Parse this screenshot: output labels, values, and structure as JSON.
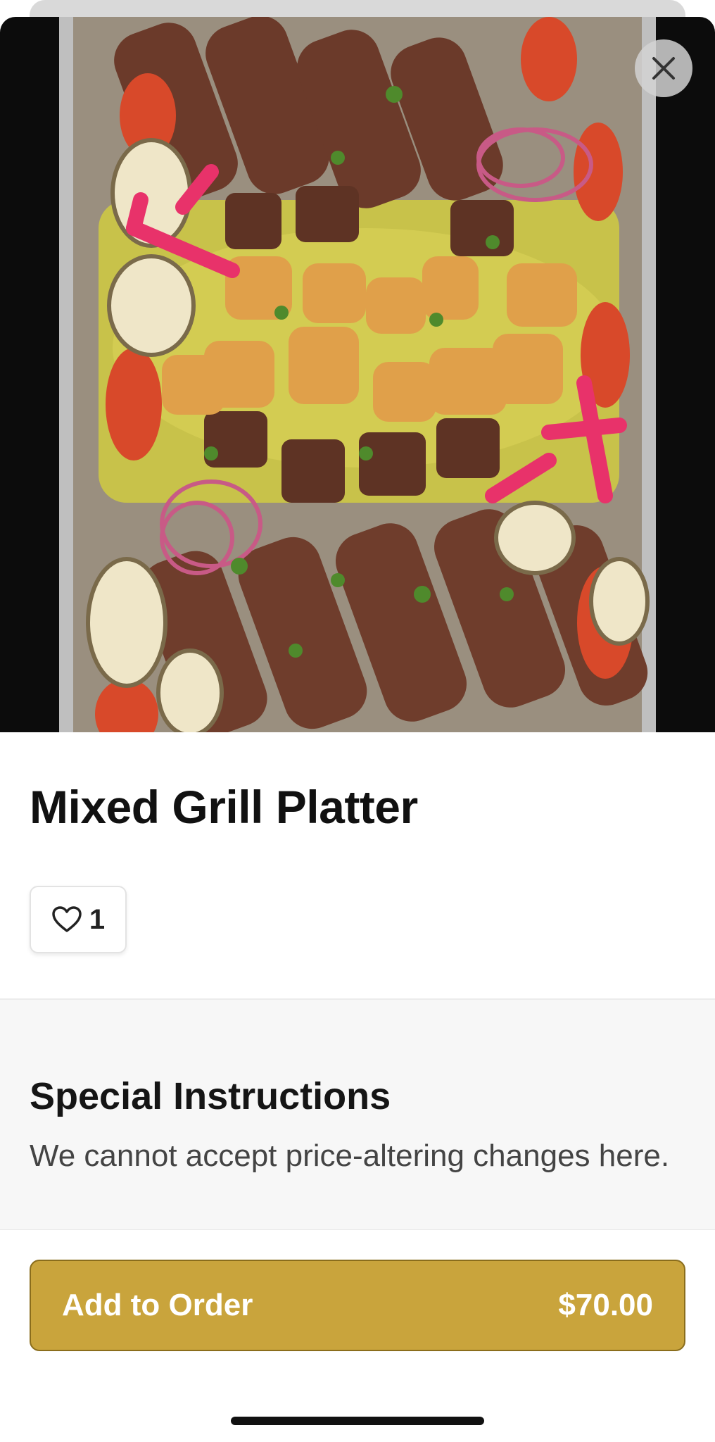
{
  "item": {
    "title": "Mixed Grill Platter",
    "image_icon": "food-photo",
    "likes": "1"
  },
  "instructions": {
    "title": "Special Instructions",
    "text": "We cannot accept price-altering changes here."
  },
  "footer": {
    "add_label": "Add to Order",
    "price": "$70.00"
  },
  "colors": {
    "accent": "#c9a43c",
    "accent_border": "#8a6d1c",
    "hero_bg": "#0c0c0c",
    "instructions_bg": "#f7f7f7"
  },
  "icons": {
    "close": "close-icon",
    "like": "heart-icon"
  }
}
